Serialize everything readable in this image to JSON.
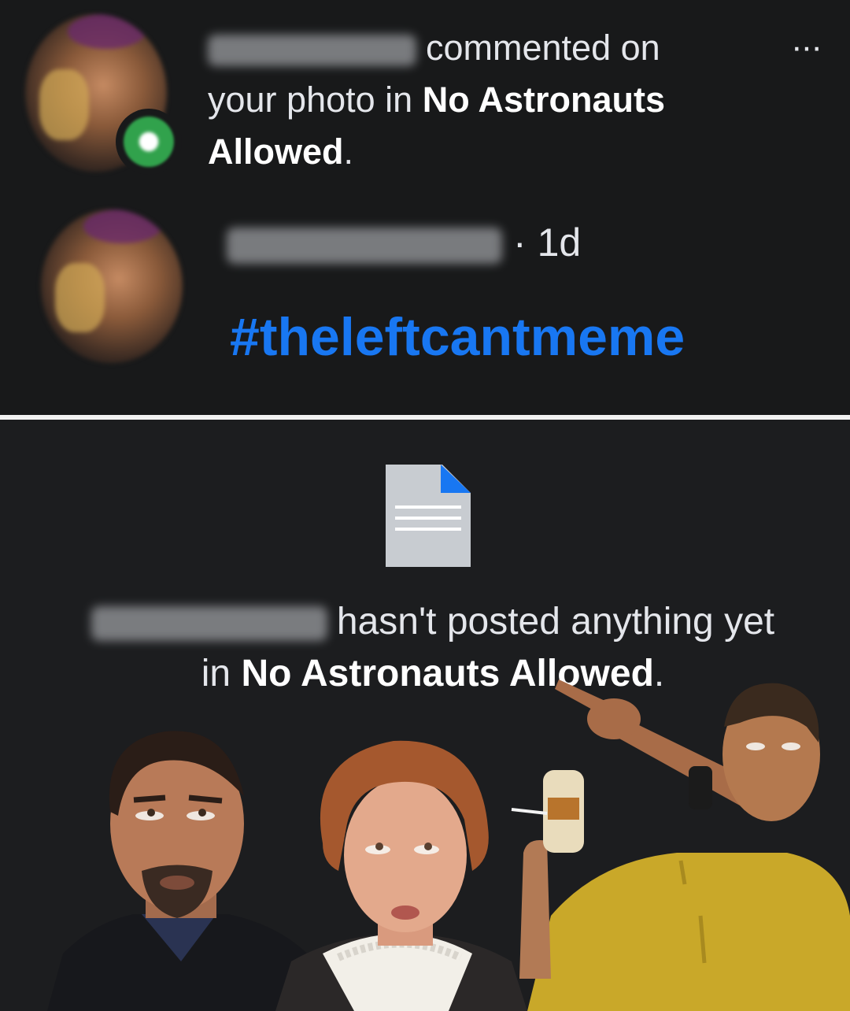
{
  "notification": {
    "verb_text": "commented on",
    "object_text": "your photo in",
    "group_name": "No Astronauts Allowed",
    "period": ".",
    "more_icon": "more-horizontal-icon",
    "more_label": "···"
  },
  "comment": {
    "separator": "·",
    "time": "1d",
    "hashtag": "#theleftcantmeme"
  },
  "empty_state": {
    "icon": "document-icon",
    "text_before": "hasn't posted anything yet in",
    "group_name": "No Astronauts Allowed",
    "period": "."
  },
  "colors": {
    "background": "#18191a",
    "hashtag": "#1877f2",
    "online_badge": "#31a24c",
    "divider": "#f2f2f2"
  }
}
